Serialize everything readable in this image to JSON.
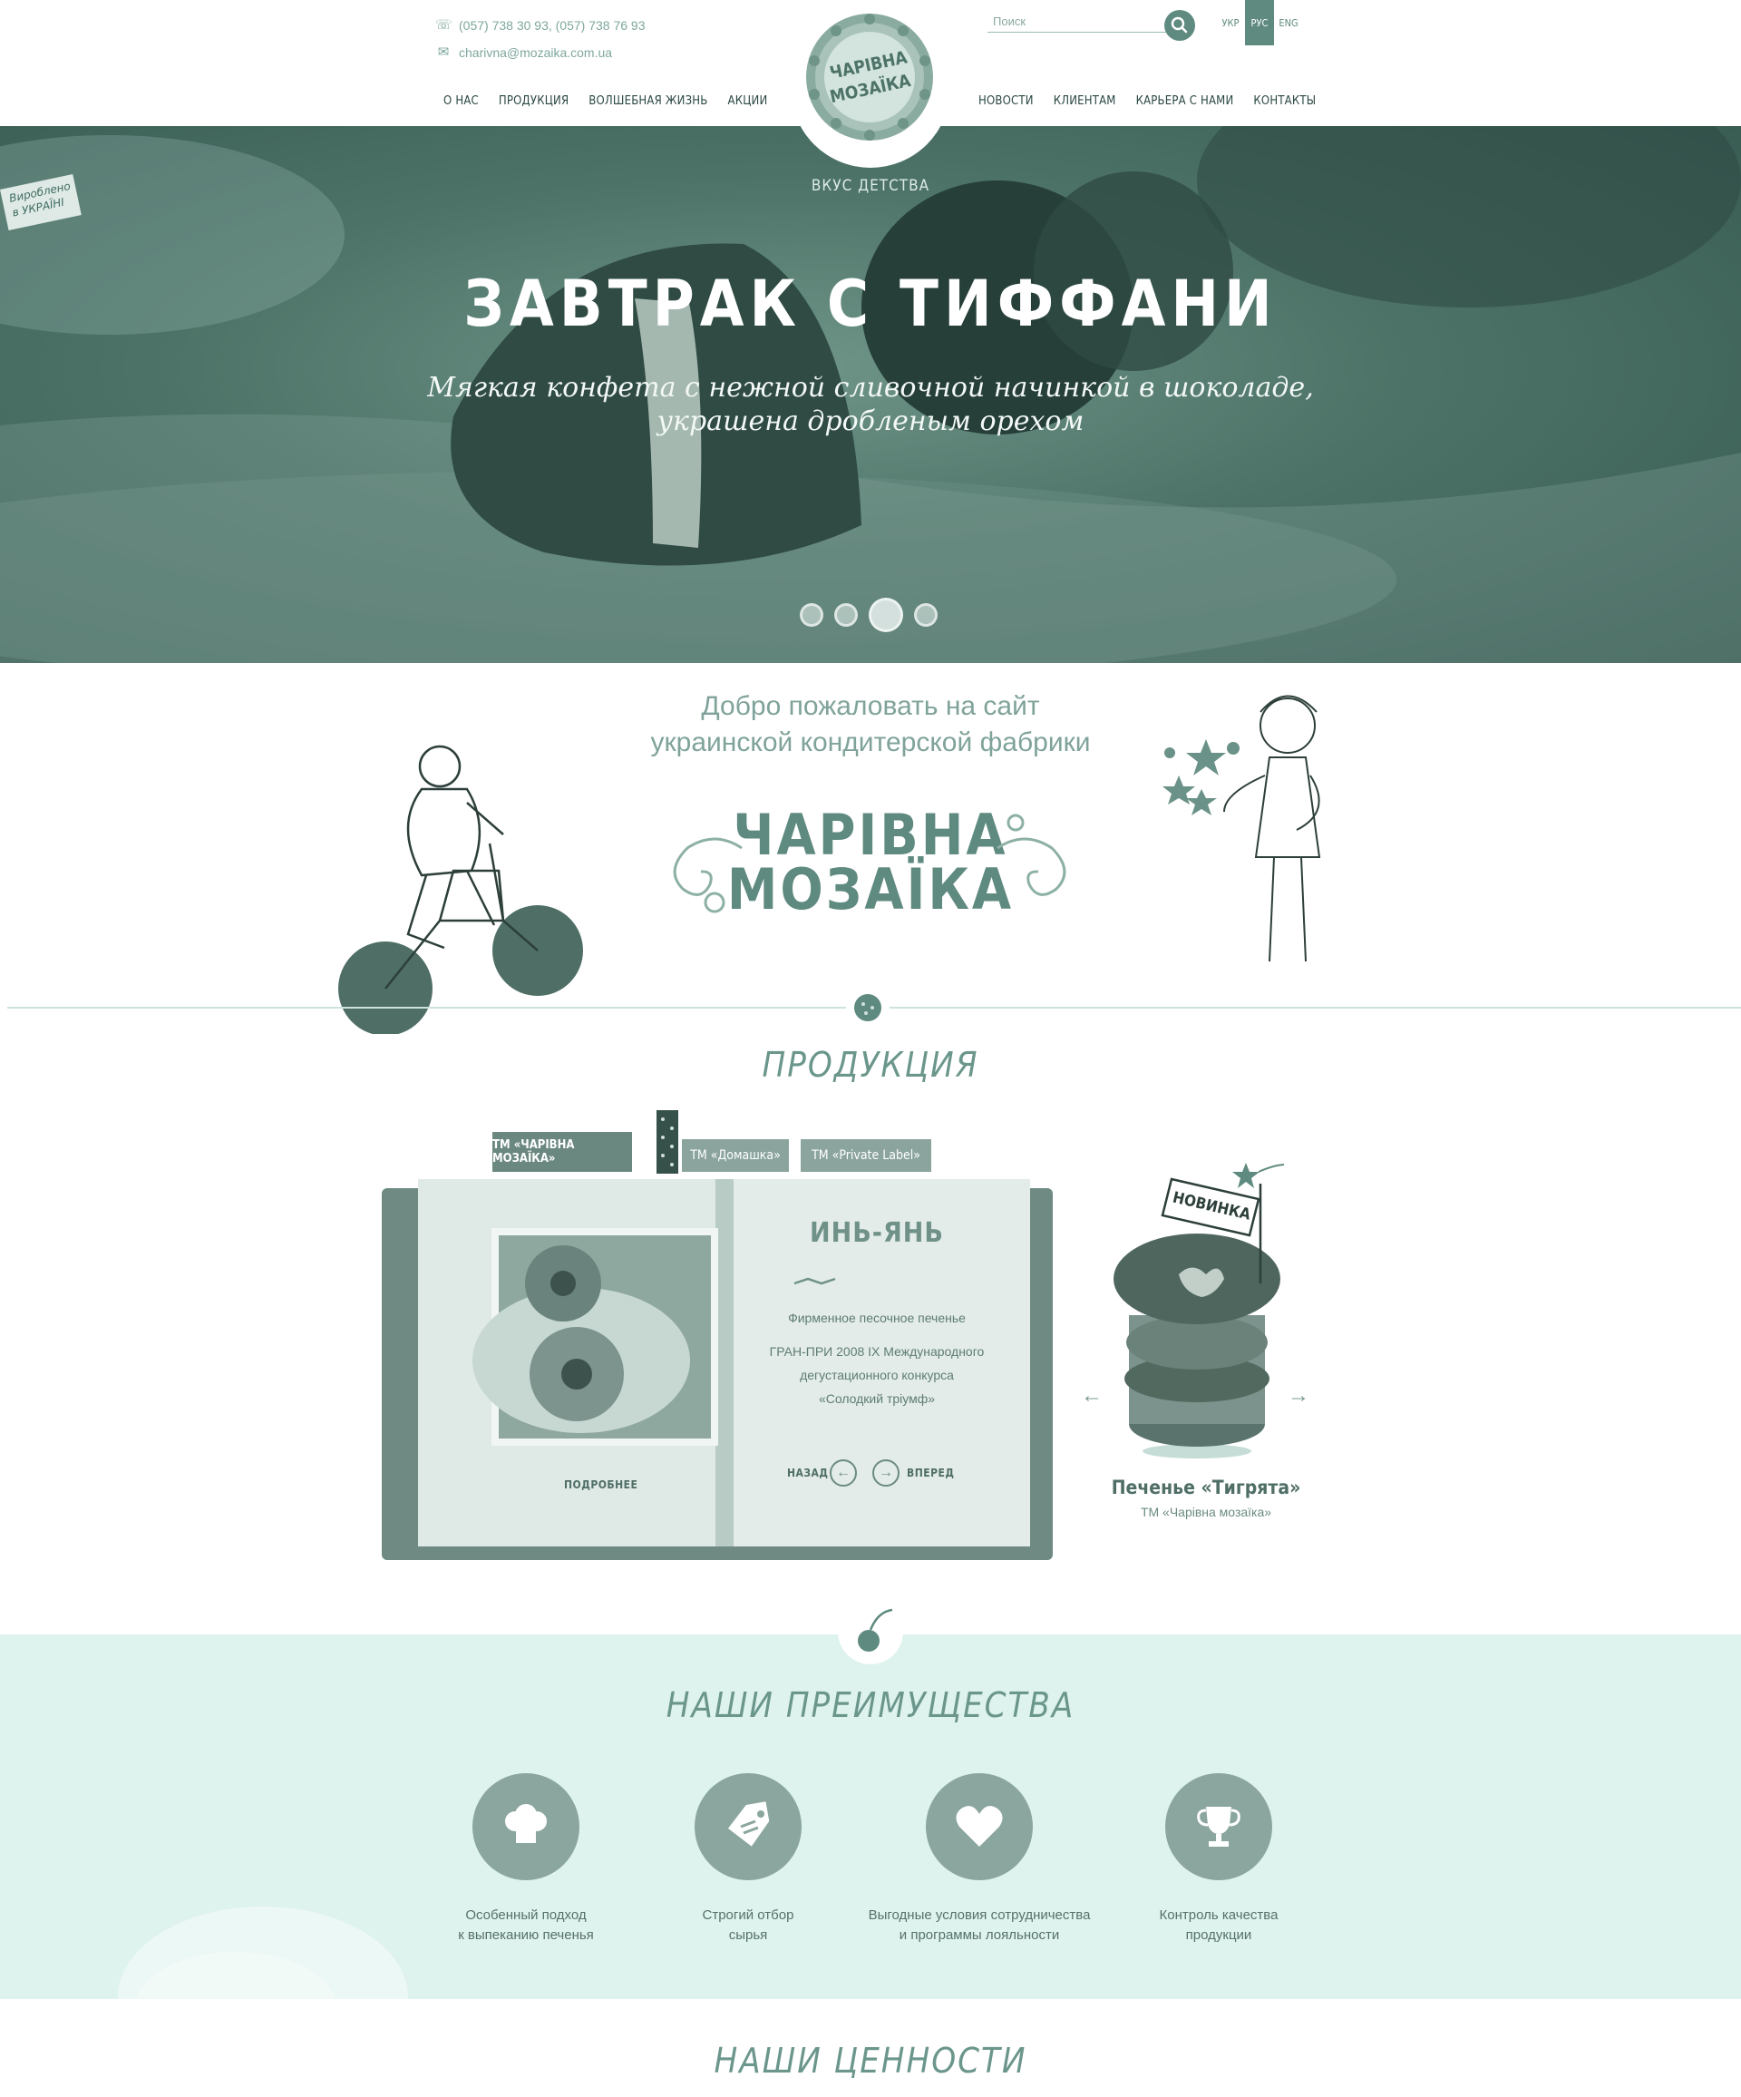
{
  "header": {
    "phones": "(057) 738 30 93, (057) 738 76 93",
    "email": "charivna@mozaika.com.ua",
    "nav_left": [
      "О НАС",
      "ПРОДУКЦИЯ",
      "ВОЛШЕБНАЯ ЖИЗНЬ",
      "АКЦИИ"
    ],
    "nav_right": [
      "НОВОСТИ",
      "КЛИЕНТАМ",
      "КАРЬЕРА С НАМИ",
      "КОНТАКТЫ"
    ],
    "search_placeholder": "Поиск",
    "languages": [
      {
        "label": "УКР",
        "active": false
      },
      {
        "label": "РУС",
        "active": true
      },
      {
        "label": "ENG",
        "active": false
      }
    ],
    "logo_text_top": "ЧАРІВНА",
    "logo_text_bottom": "МОЗАЇКА"
  },
  "hero": {
    "tagline": "ВКУС ДЕТСТВА",
    "badge_line1": "Вироблено",
    "badge_line2": "в УКРАЇНІ",
    "title": "ЗАВТРАК С ТИФФАНИ",
    "subtitle_line1": "Мягкая конфета с нежной сливочной начинкой в шоколаде,",
    "subtitle_line2": "украшена дробленым орехом",
    "slides": 4,
    "active_slide": 3
  },
  "welcome": {
    "line1": "Добро пожаловать на сайт",
    "line2": "украинской кондитерской фабрики",
    "brand_line1": "ЧАРІВНА",
    "brand_line2": "МОЗАЇКА"
  },
  "products": {
    "title": "ПРОДУКЦИЯ",
    "tabs": [
      "ТМ «ЧАРІВНА МОЗАЇКА»",
      "ТМ «Домашка»",
      "ТМ «Private Label»"
    ],
    "book_title": "ИНЬ-ЯНЬ",
    "book_desc": "Фирменное песочное печенье",
    "award_line1": "ГРАН-ПРИ 2008 IX Международного",
    "award_line2": "дегустационного конкурса",
    "award_line3": "«Солодкий тріумф»",
    "more": "ПОДРОБНЕЕ",
    "back": "НАЗАД",
    "forward": "ВПЕРЕД",
    "new_flag": "НОВИНКА",
    "featured_name": "Печенье «Тигрята»",
    "featured_brand": "ТМ «Чарівна мозаїка»"
  },
  "advantages": {
    "title": "НАШИ ПРЕИМУЩЕСТВА",
    "items": [
      {
        "line1": "Особенный  подход",
        "line2": "к выпеканию печенья",
        "icon": "chef-hat-icon"
      },
      {
        "line1": "Строгий отбор",
        "line2": "сырья",
        "icon": "tag-icon"
      },
      {
        "line1": "Выгодные условия сотрудничества",
        "line2": "и программы лояльности",
        "icon": "heart-icon"
      },
      {
        "line1": "Контроль качества",
        "line2": "продукции",
        "icon": "trophy-icon"
      }
    ]
  },
  "values": {
    "title": "НАШИ ЦЕННОСТИ"
  },
  "colors": {
    "accent": "#5f8a7f",
    "hero_bg": "#4d7368",
    "advantages_bg": "#dff3ee"
  }
}
